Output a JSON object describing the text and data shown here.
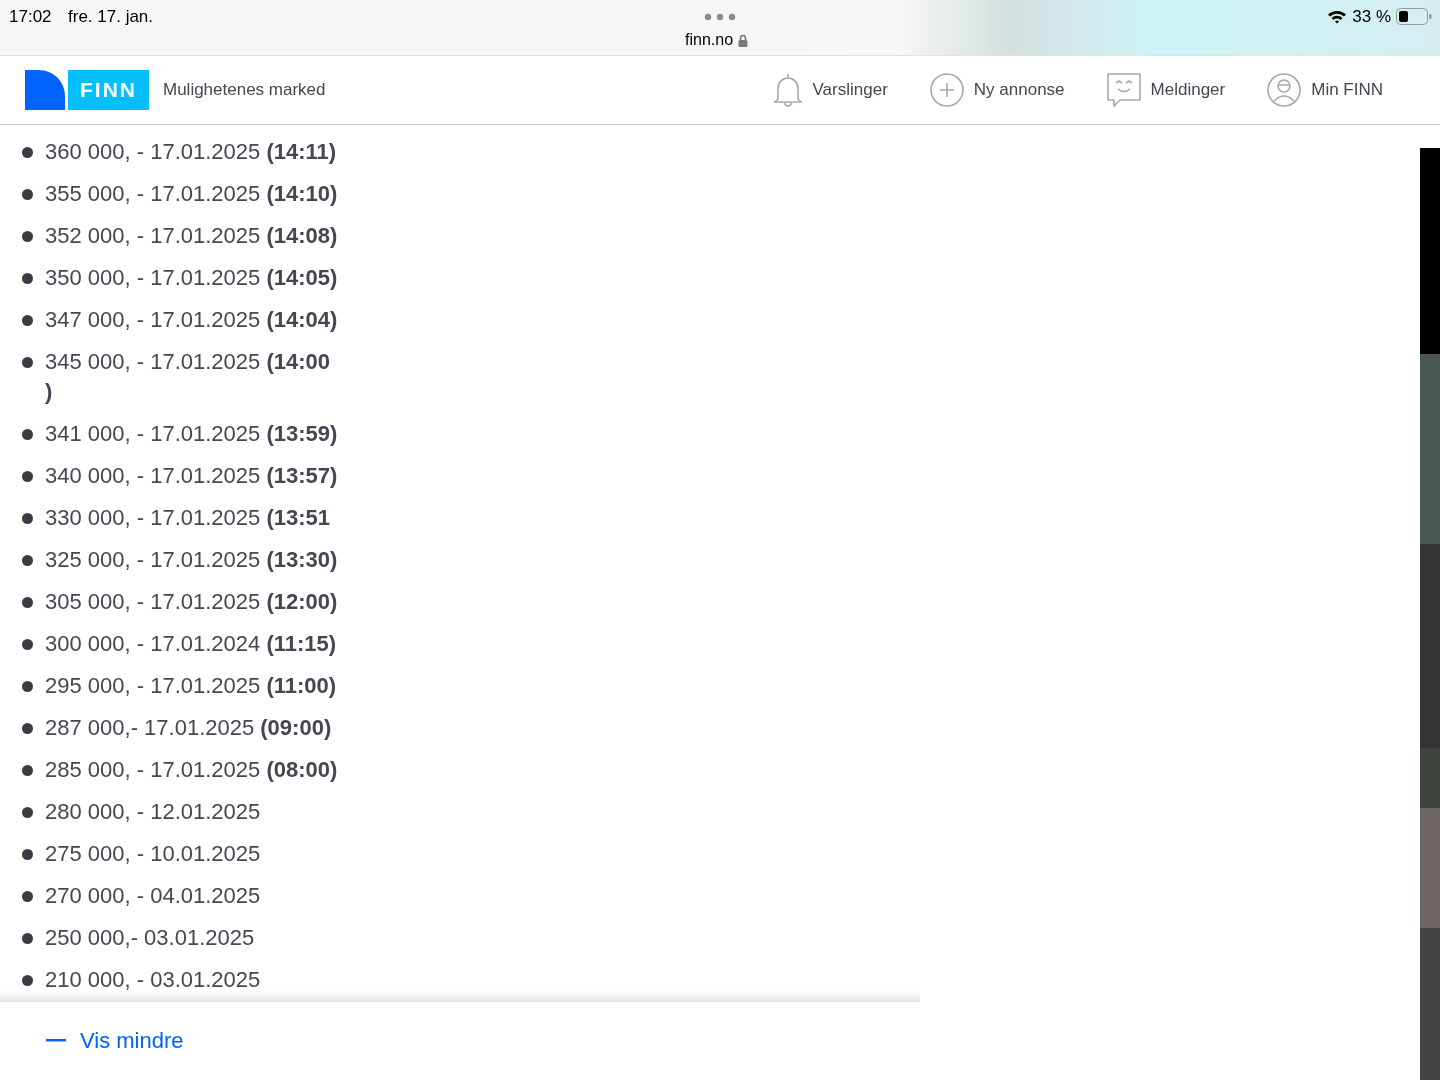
{
  "status_bar": {
    "time": "17:02",
    "date": "fre. 17. jan.",
    "url": "finn.no",
    "battery": "33 %"
  },
  "header": {
    "logo": "FINN",
    "tagline": "Mulighetenes marked",
    "nav": [
      {
        "label": "Varslinger",
        "kind": "bell"
      },
      {
        "label": "Ny annonse",
        "kind": "plus"
      },
      {
        "label": "Meldinger",
        "kind": "chat"
      },
      {
        "label": "Min FINN",
        "kind": "user"
      }
    ]
  },
  "price_history": [
    "360 000, - 17.01.2025 **(14:11)**",
    "355 000, - 17.01.2025 **(14:10)**",
    "352 000, - 17.01.2025 **(14:08)**",
    "350 000, - 17.01.2025 **(14:05)**",
    "347 000, - 17.01.2025 **(14:04)**",
    "345 000, - 17.01.2025 **(14:00**\n**)**",
    "341 000, - 17.01.2025 **(13:59)**",
    "340 000, - 17.01.2025 **(13:57)**",
    "330 000, - 17.01.2025 **(13:51**",
    "325 000, - 17.01.2025 **(13:30)**",
    "305 000, - 17.01.2025 **(12:00)**",
    "300 000, - 17.01.2024 **(11:15)**",
    "295 000, - 17.01.2025 **(11:00)**",
    "287 000,- 17.01.2025 **(09:00)**",
    "285 000, - 17.01.2025 **(08:00)**",
    "280 000, - 12.01.2025",
    "275 000, - 10.01.2025",
    "270 000, - 04.01.2025",
    "250 000,- 03.01.2025",
    "210 000, - 03.01.2025"
  ],
  "toggle": {
    "label": "Vis mindre"
  }
}
